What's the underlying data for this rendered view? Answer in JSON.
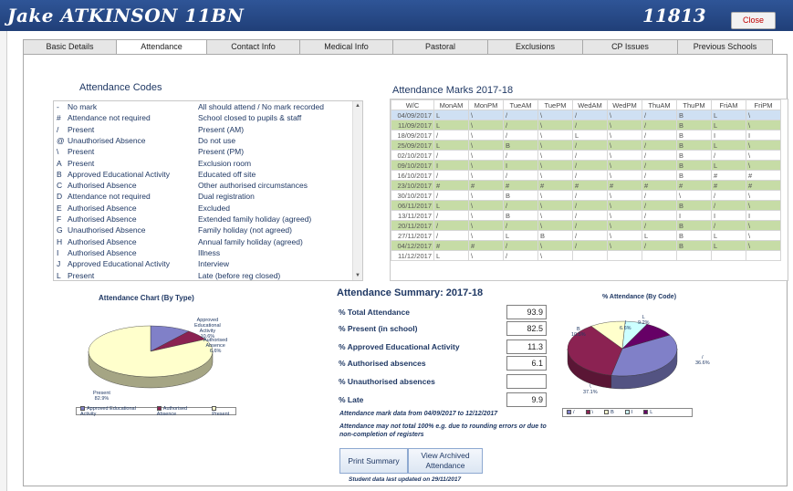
{
  "header": {
    "student_name": "Jake ATKINSON   11BN",
    "student_id": "11813",
    "close_label": "Close"
  },
  "tabs": [
    {
      "label": "Basic Details",
      "active": false
    },
    {
      "label": "Attendance",
      "active": true
    },
    {
      "label": "Contact Info",
      "active": false
    },
    {
      "label": "Medical Info",
      "active": false
    },
    {
      "label": "Pastoral",
      "active": false
    },
    {
      "label": "Exclusions",
      "active": false
    },
    {
      "label": "CP Issues",
      "active": false
    },
    {
      "label": "Previous Schools",
      "active": false
    }
  ],
  "codes": {
    "title": "Attendance Codes",
    "rows": [
      {
        "code": "-",
        "category": "No mark",
        "description": "All should attend / No mark recorded"
      },
      {
        "code": "#",
        "category": "Attendance not required",
        "description": "School closed to pupils & staff"
      },
      {
        "code": "/",
        "category": "Present",
        "description": "Present (AM)"
      },
      {
        "code": "@",
        "category": "Unauthorised Absence",
        "description": "Do not use"
      },
      {
        "code": "\\",
        "category": "Present",
        "description": "Present (PM)"
      },
      {
        "code": "A",
        "category": "Present",
        "description": "Exclusion room"
      },
      {
        "code": "B",
        "category": "Approved Educational Activity",
        "description": "Educated off site"
      },
      {
        "code": "C",
        "category": "Authorised Absence",
        "description": "Other authorised circumstances"
      },
      {
        "code": "D",
        "category": "Attendance not required",
        "description": "Dual registration"
      },
      {
        "code": "E",
        "category": "Authorised Absence",
        "description": "Excluded"
      },
      {
        "code": "F",
        "category": "Authorised Absence",
        "description": "Extended family holiday (agreed)"
      },
      {
        "code": "G",
        "category": "Unauthorised Absence",
        "description": "Family holiday (not agreed)"
      },
      {
        "code": "H",
        "category": "Authorised Absence",
        "description": "Annual family holiday (agreed)"
      },
      {
        "code": "I",
        "category": "Authorised Absence",
        "description": "Illness"
      },
      {
        "code": "J",
        "category": "Approved Educational Activity",
        "description": "Interview"
      },
      {
        "code": "L",
        "category": "Present",
        "description": "Late (before reg closed)"
      }
    ]
  },
  "marks": {
    "title": "Attendance Marks 2017-18",
    "headers": [
      "W/C",
      "MonAM",
      "MonPM",
      "TueAM",
      "TuePM",
      "WedAM",
      "WedPM",
      "ThuAM",
      "ThuPM",
      "FriAM",
      "FriPM"
    ],
    "rows": [
      [
        "04/09/2017",
        "L",
        "\\",
        "/",
        "\\",
        "/",
        "\\",
        "/",
        "B",
        "L",
        "\\"
      ],
      [
        "11/09/2017",
        "L",
        "\\",
        "/",
        "\\",
        "/",
        "\\",
        "/",
        "B",
        "L",
        "\\"
      ],
      [
        "18/09/2017",
        "/",
        "\\",
        "/",
        "\\",
        "L",
        "\\",
        "/",
        "B",
        "I",
        "I"
      ],
      [
        "25/09/2017",
        "L",
        "\\",
        "B",
        "\\",
        "/",
        "\\",
        "/",
        "B",
        "L",
        "\\"
      ],
      [
        "02/10/2017",
        "/",
        "\\",
        "/",
        "\\",
        "/",
        "\\",
        "/",
        "B",
        "/",
        "\\"
      ],
      [
        "09/10/2017",
        "I",
        "\\",
        "I",
        "\\",
        "/",
        "\\",
        "/",
        "B",
        "L",
        "\\"
      ],
      [
        "16/10/2017",
        "/",
        "\\",
        "/",
        "\\",
        "/",
        "\\",
        "/",
        "B",
        "#",
        "#"
      ],
      [
        "23/10/2017",
        "#",
        "#",
        "#",
        "#",
        "#",
        "#",
        "#",
        "#",
        "#",
        "#"
      ],
      [
        "30/10/2017",
        "/",
        "\\",
        "B",
        "\\",
        "/",
        "\\",
        "/",
        "\\",
        "/",
        "\\"
      ],
      [
        "06/11/2017",
        "L",
        "\\",
        "/",
        "\\",
        "/",
        "\\",
        "/",
        "B",
        "/",
        "\\"
      ],
      [
        "13/11/2017",
        "/",
        "\\",
        "B",
        "\\",
        "/",
        "\\",
        "/",
        "I",
        "I",
        "I"
      ],
      [
        "20/11/2017",
        "/",
        "\\",
        "/",
        "\\",
        "/",
        "\\",
        "/",
        "B",
        "/",
        "\\"
      ],
      [
        "27/11/2017",
        "/",
        "\\",
        "L",
        "B",
        "/",
        "\\",
        "L",
        "B",
        "L",
        "\\"
      ],
      [
        "04/12/2017",
        "#",
        "#",
        "/",
        "\\",
        "/",
        "\\",
        "/",
        "B",
        "L",
        "\\"
      ],
      [
        "11/12/2017",
        "L",
        "\\",
        "/",
        "\\",
        "",
        "",
        "",
        "",
        "",
        ""
      ]
    ]
  },
  "summary": {
    "title": "Attendance Summary: 2017-18",
    "rows": [
      {
        "label": "% Total Attendance",
        "value": "93.9"
      },
      {
        "label": "% Present (in school)",
        "value": "82.5"
      },
      {
        "label": "% Approved Educational Activity",
        "value": "11.3"
      },
      {
        "label": "% Authorised absences",
        "value": "6.1"
      },
      {
        "label": "% Unauthorised absences",
        "value": ""
      },
      {
        "label": "% Late",
        "value": "9.9"
      }
    ],
    "note1": "Attendance mark data from 04/09/2017 to 12/12/2017",
    "note2": "Attendance may not total 100% e.g. due to rounding errors or due to",
    "note3": "non-completion of registers",
    "print_label": "Print Summary",
    "archive_label_1": "View Archived",
    "archive_label_2": "Attendance",
    "updated": "Student data last updated on 29/11/2017"
  },
  "chart_data": [
    {
      "type": "pie",
      "title": "Attendance Chart (By Type)",
      "categories": [
        "Approved Educational Activity",
        "Authorised Absence",
        "Present"
      ],
      "values": [
        10.6,
        6.6,
        82.9
      ],
      "labels": {
        "aea": "Approved",
        "aea2": "Educational",
        "aea3": "Activity",
        "aea_pct": "10.6%",
        "auth": "Authorised",
        "auth2": "Absence",
        "auth_pct": "6.6%",
        "present": "Present",
        "present_pct": "82.9%"
      },
      "colors": [
        "#8080c8",
        "#8b2252",
        "#ffffcc"
      ],
      "legend": "bottom"
    },
    {
      "type": "pie",
      "title": "% Attendance (By Code)",
      "categories": [
        "/",
        "\\",
        "B",
        "I",
        "L"
      ],
      "values": [
        36.6,
        37.1,
        10.5,
        6.6,
        9.2
      ],
      "labels": {
        "slash": "/",
        "slash_pct": "36.6%",
        "back": "\\",
        "back_pct": "37.1%",
        "b": "B",
        "b_pct": "10.5%",
        "i": "I",
        "i_pct": "6.6%",
        "l": "L",
        "l_pct": "9.2%"
      },
      "colors": [
        "#8080c8",
        "#8b2252",
        "#ffffcc",
        "#ccffff",
        "#660066"
      ],
      "legend": "bottom"
    }
  ]
}
